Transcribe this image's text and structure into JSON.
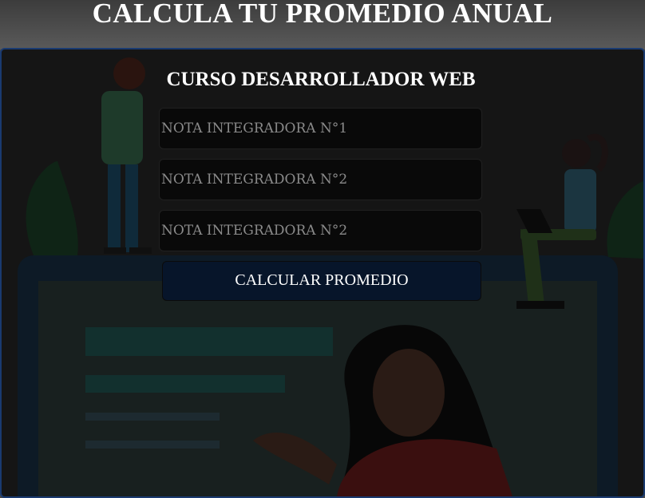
{
  "header": {
    "title": "CALCULA TU PROMEDIO ANUAL"
  },
  "card": {
    "subtitle": "CURSO DESARROLLADOR WEB",
    "inputs": [
      {
        "placeholder": "NOTA INTEGRADORA N°1",
        "value": ""
      },
      {
        "placeholder": "NOTA INTEGRADORA N°2",
        "value": ""
      },
      {
        "placeholder": "NOTA INTEGRADORA N°2",
        "value": ""
      }
    ],
    "button_label": "CALCULAR PROMEDIO"
  },
  "colors": {
    "header_bg": "#4a4a4a",
    "panel_border": "#1a3a70",
    "button_bg": "#07152a",
    "text": "#ffffff"
  },
  "icons": [
    "background-illustration"
  ]
}
